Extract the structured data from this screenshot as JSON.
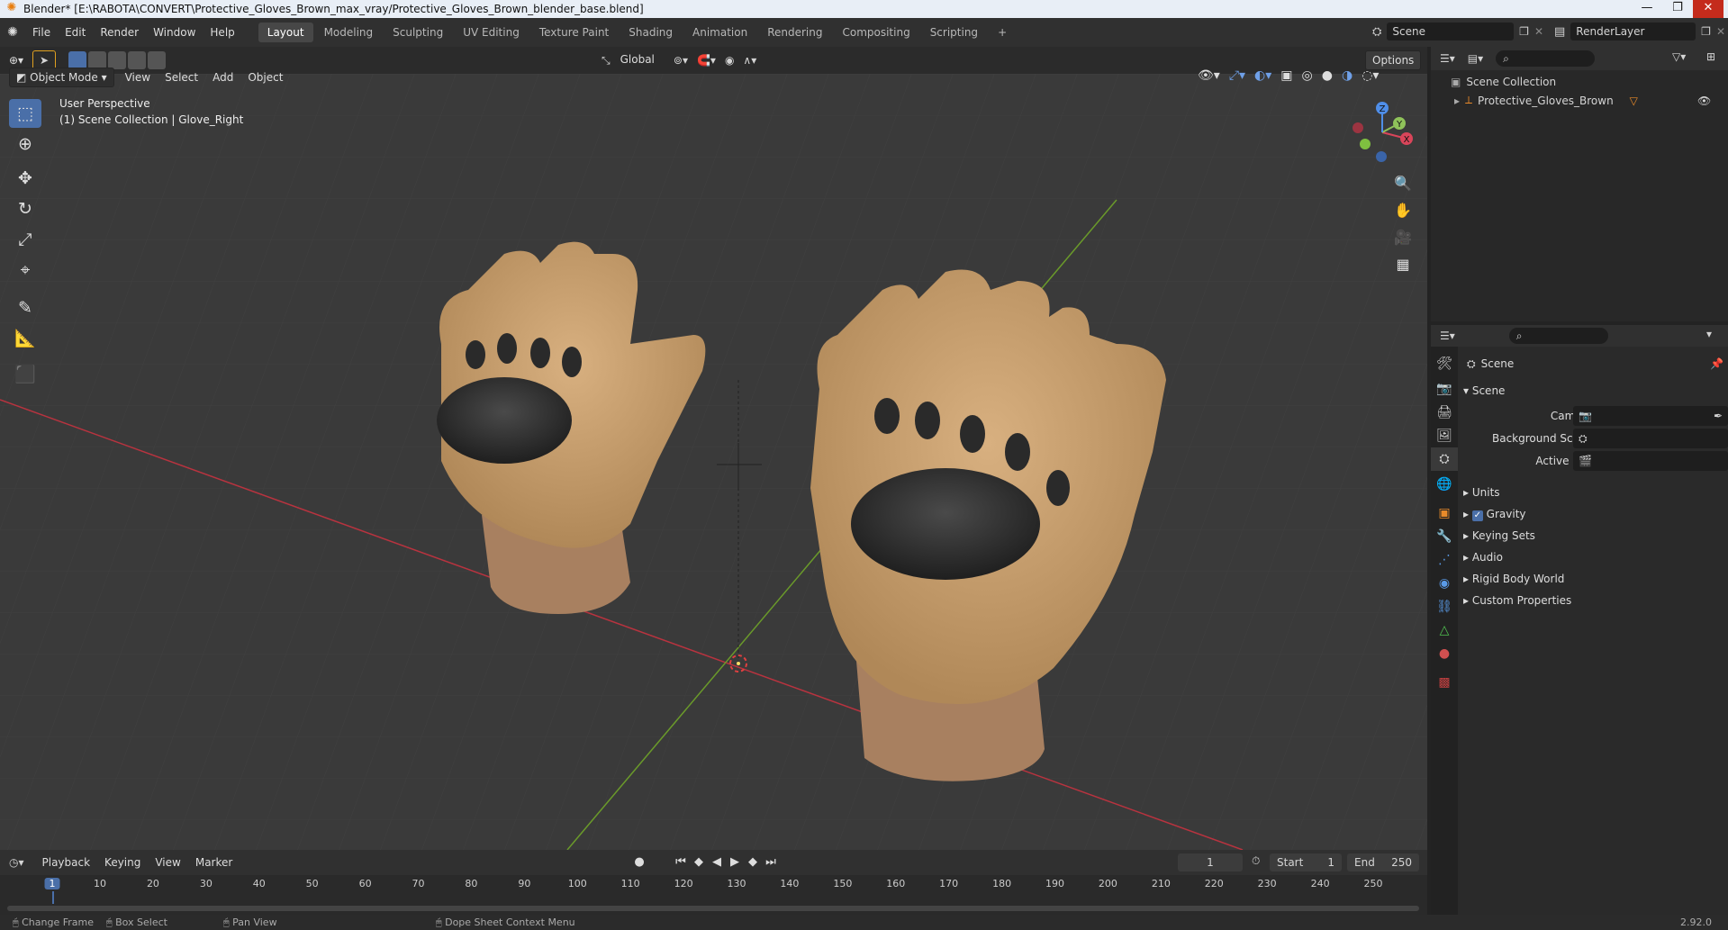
{
  "window": {
    "title": "Blender* [E:\\RABOTA\\CONVERT\\Protective_Gloves_Brown_max_vray/Protective_Gloves_Brown_blender_base.blend]"
  },
  "menus": [
    "File",
    "Edit",
    "Render",
    "Window",
    "Help"
  ],
  "workspaces": [
    "Layout",
    "Modeling",
    "Sculpting",
    "UV Editing",
    "Texture Paint",
    "Shading",
    "Animation",
    "Rendering",
    "Compositing",
    "Scripting"
  ],
  "scene_name": "Scene",
  "view_layer": "RenderLayer",
  "toolheader": {
    "orientation": "Global",
    "options": "Options"
  },
  "viewport_header": {
    "mode": "Object Mode",
    "menus": [
      "View",
      "Select",
      "Add",
      "Object"
    ]
  },
  "viewport": {
    "perspective": "User Perspective",
    "context": "(1) Scene Collection | Glove_Right"
  },
  "gizmo": {
    "x": "X",
    "y": "Y",
    "z": "Z"
  },
  "outliner": {
    "root": "Scene Collection",
    "items": [
      {
        "name": "Protective_Gloves_Brown"
      }
    ]
  },
  "properties": {
    "breadcrumb": "Scene",
    "panel": "Scene",
    "fields": [
      {
        "label": "Camera"
      },
      {
        "label": "Background Scene"
      },
      {
        "label": "Active Clip"
      }
    ],
    "subpanels": [
      {
        "label": "Units",
        "checkbox": false
      },
      {
        "label": "Gravity",
        "checkbox": true
      },
      {
        "label": "Keying Sets",
        "checkbox": false
      },
      {
        "label": "Audio",
        "checkbox": false
      },
      {
        "label": "Rigid Body World",
        "checkbox": false
      },
      {
        "label": "Custom Properties",
        "checkbox": false
      }
    ]
  },
  "timeline": {
    "menus": [
      "Playback",
      "Keying",
      "View",
      "Marker"
    ],
    "current_frame": "1",
    "start_label": "Start",
    "start": "1",
    "end_label": "End",
    "end": "250",
    "ticks": [
      "1",
      "10",
      "20",
      "30",
      "40",
      "50",
      "60",
      "70",
      "80",
      "90",
      "100",
      "110",
      "120",
      "130",
      "140",
      "150",
      "160",
      "170",
      "180",
      "190",
      "200",
      "210",
      "220",
      "230",
      "240",
      "250"
    ]
  },
  "statusbar": {
    "items": [
      "Change Frame",
      "Box Select",
      "Pan View",
      "Dope Sheet Context Menu"
    ],
    "version": "2.92.0"
  },
  "colors": {
    "accent": "#4a6fa8",
    "x_axis": "#b8333f",
    "y_axis": "#6a9a2a",
    "glove_tan": "#c9a070",
    "knuckle_dark": "#2a2a2a"
  }
}
